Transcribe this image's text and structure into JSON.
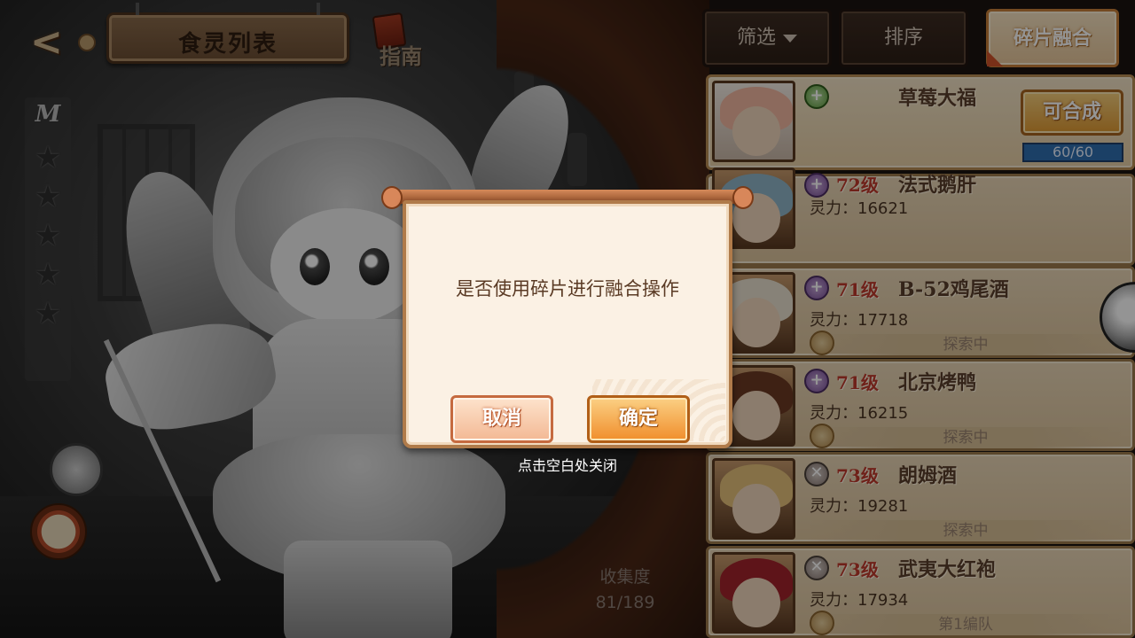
{
  "header": {
    "title": "食灵列表",
    "guide_label": "指南"
  },
  "rarity": {
    "letter": "M",
    "stars": 5
  },
  "collection": {
    "label": "收集度",
    "value": "81/189"
  },
  "toolbar": {
    "filter_label": "筛选",
    "sort_label": "排序",
    "fragment_label": "碎片融合"
  },
  "featured": {
    "name": "草莓大福",
    "merge_label": "可合成",
    "progress": "60/60",
    "progress_fraction": 1.0
  },
  "list": [
    {
      "level": "72级",
      "name": "法式鹅肝",
      "power": "灵力：16621",
      "status": ""
    },
    {
      "level": "71级",
      "name": "B-52鸡尾酒",
      "power": "灵力：17718",
      "status": "探索中"
    },
    {
      "level": "71级",
      "name": "北京烤鸭",
      "power": "灵力：16215",
      "status": "探索中"
    },
    {
      "level": "73级",
      "name": "朗姆酒",
      "power": "灵力：19281",
      "status": "探索中"
    },
    {
      "level": "73级",
      "name": "武夷大红袍",
      "power": "灵力：17934",
      "status": "第1编队"
    }
  ],
  "dialog": {
    "message": "是否使用碎片进行融合操作",
    "cancel_label": "取消",
    "confirm_label": "确定",
    "close_hint": "点击空白处关闭"
  },
  "icons": {
    "back": "back-arrow-icon",
    "guide": "book-icon",
    "plus": "plus-icon",
    "sword": "sword-icon",
    "filter_caret": "caret-down-icon"
  },
  "colors": {
    "accent_orange": "#f08e2c",
    "level_red": "#c0392b",
    "progress_blue": "#2f6fb0"
  }
}
